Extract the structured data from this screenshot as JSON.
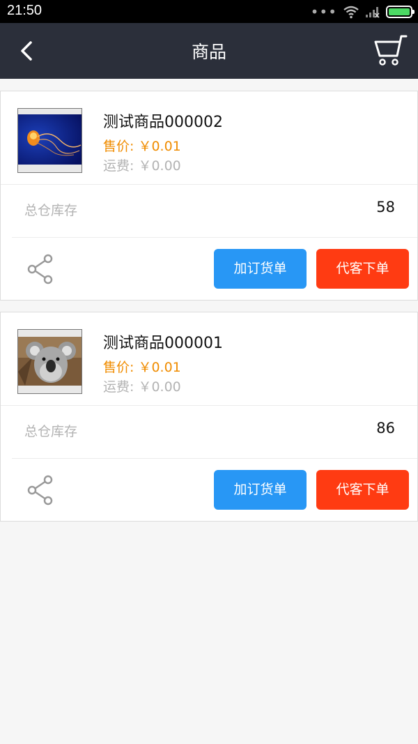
{
  "status_bar": {
    "time": "21:50",
    "dots": "•••"
  },
  "header": {
    "title": "商品"
  },
  "products": [
    {
      "name": "测试商品000002",
      "price_label": "售价:",
      "price": "￥0.01",
      "shipping_label": "运费:",
      "shipping": "￥0.00",
      "stock_label": "总仓库存",
      "stock": "58",
      "add_order_label": "加订货单",
      "place_order_label": "代客下单",
      "image": "jellyfish-photo"
    },
    {
      "name": "测试商品000001",
      "price_label": "售价:",
      "price": "￥0.01",
      "shipping_label": "运费:",
      "shipping": "￥0.00",
      "stock_label": "总仓库存",
      "stock": "86",
      "add_order_label": "加订货单",
      "place_order_label": "代客下单",
      "image": "koala-photo"
    }
  ],
  "colors": {
    "nav_bg": "#2b2f3a",
    "price": "#f08c00",
    "add_order_button": "#2897f5",
    "place_order_button": "#ff3b12"
  }
}
